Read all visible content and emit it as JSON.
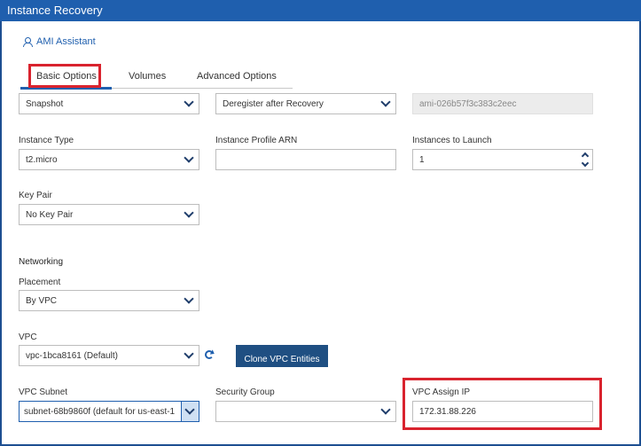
{
  "window": {
    "title": "Instance Recovery"
  },
  "ami_assistant": {
    "label": "AMI Assistant",
    "icon": "user-icon"
  },
  "tabs": [
    {
      "label": "Basic Options",
      "active": true
    },
    {
      "label": "Volumes"
    },
    {
      "label": "Advanced Options"
    }
  ],
  "row1": {
    "source": {
      "value": "Snapshot"
    },
    "after_recovery": {
      "value": "Deregister after Recovery"
    },
    "ami_id": {
      "value": "ami-026b57f3c383c2eec"
    }
  },
  "row2": {
    "instance_type": {
      "label": "Instance Type",
      "value": "t2.micro"
    },
    "instance_profile": {
      "label": "Instance Profile ARN",
      "value": ""
    },
    "instances_to_launch": {
      "label": "Instances to Launch",
      "value": "1"
    }
  },
  "key_pair": {
    "label": "Key Pair",
    "value": "No Key Pair"
  },
  "networking": {
    "title": "Networking",
    "placement": {
      "label": "Placement",
      "value": "By VPC"
    },
    "vpc": {
      "label": "VPC",
      "value": "vpc-1bca8161 (Default)",
      "clone_button": "Clone VPC Entities"
    },
    "vpc_subnet": {
      "label": "VPC Subnet",
      "value": "subnet-68b9860f (default for us-east-1"
    },
    "security_group": {
      "label": "Security Group",
      "value": ""
    },
    "vpc_assign_ip": {
      "label": "VPC Assign IP",
      "value": "172.31.88.226"
    }
  },
  "colors": {
    "accent": "#1f5fae",
    "highlight": "#d9232e",
    "button": "#1f4f82"
  }
}
